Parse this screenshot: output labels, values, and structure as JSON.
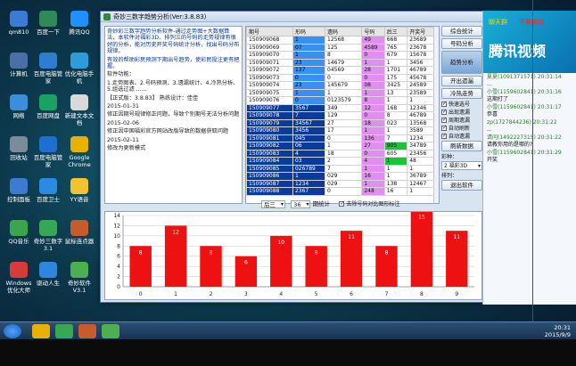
{
  "desktop_icons": [
    {
      "label": "qm810",
      "color": "#3a7bd5"
    },
    {
      "label": "百度一下",
      "color": "#2e8b57"
    },
    {
      "label": "腾讯QQ",
      "color": "#1e90ff"
    },
    {
      "label": "计算机",
      "color": "#4a6fa5"
    },
    {
      "label": "百度电脑管家",
      "color": "#2d7dd2"
    },
    {
      "label": "优化电脑手机",
      "color": "#2d9cdb"
    },
    {
      "label": "网络",
      "color": "#3a8edb"
    },
    {
      "label": "百度网盘",
      "color": "#1aa260"
    },
    {
      "label": "新建文本文档",
      "color": "#d9d9d9"
    },
    {
      "label": "回收站",
      "color": "#7a8b99"
    },
    {
      "label": "百度电脑管家",
      "color": "#1d6fd2"
    },
    {
      "label": "Google Chrome",
      "color": "#e8b100"
    },
    {
      "label": "控制面板",
      "color": "#3b7bd0"
    },
    {
      "label": "百度卫士",
      "color": "#2b8be0"
    },
    {
      "label": "YY语音",
      "color": "#f2c230"
    },
    {
      "label": "QQ音乐",
      "color": "#3aa64b"
    },
    {
      "label": "奇妙三数字3.1",
      "color": "#34a853"
    },
    {
      "label": "鼠标连点器",
      "color": "#c85b2b"
    },
    {
      "label": "Windows优化大师",
      "color": "#d93a3a"
    },
    {
      "label": "驱动人生",
      "color": "#2e86de"
    },
    {
      "label": "奇妙软件V3.1",
      "color": "#4caf50"
    }
  ],
  "window": {
    "title": "奇妙三数字趋势分析(Ver:3.8.83)"
  },
  "intro": [
    "奇妙彩三数字趋势分析软件-通过走势图+大数据算法，本软件对福彩3D、排列三的号码的走势规律有很好的分析，能对历史开奖号码统计分析，找出号码分布规律。",
    "有效的帮助彩民预测下期出号趋势，使彩民投注更有把握。",
    "软件功能：",
    "1.走势图表、2.号码预测、3.遗漏统计、4.冷热分析、5.组选过滤 ......",
    "【正式版：3.8.83】 熟练设计：佳佳",
    "2015-01-31",
    "修正因期号规律修正问题，导致个别期号无法分析问题",
    "2015-02-06",
    "修正因中国福彩官方网站改版导致的数据获取问题",
    "2015-02-11",
    "修改为更新模式"
  ],
  "table": {
    "headers": [
      "期号",
      "形码",
      "遗码",
      "号码",
      "后三",
      "开奖号"
    ],
    "rows": [
      [
        "150909068",
        "1",
        "12568",
        "49",
        "668",
        "23689"
      ],
      [
        "150909069",
        "07",
        "125",
        "4589",
        "765",
        "23678"
      ],
      [
        "150909070",
        "1",
        "8",
        "0",
        "679",
        "15678"
      ],
      [
        "150909071",
        "23",
        "14679",
        "1",
        "1",
        "3456"
      ],
      [
        "150909072",
        "137",
        "04569",
        "28",
        "1701",
        "46789"
      ],
      [
        "150909073",
        "0",
        "0",
        "0",
        "175",
        "45678"
      ],
      [
        "150909074",
        "23",
        "145679",
        "08",
        "3425",
        "24589"
      ],
      [
        "150909075",
        "1",
        "1",
        "1",
        "13",
        "23589"
      ],
      [
        "150909076",
        "0",
        "0123579",
        "8",
        "1",
        "1"
      ],
      [
        "150909077",
        "3567",
        "349",
        "12",
        "168",
        "12346"
      ],
      [
        "150909078",
        "7",
        "129",
        "0",
        "8",
        "46789"
      ],
      [
        "150909079",
        "34567",
        "27",
        "18",
        "023",
        "13568"
      ],
      [
        "150909080",
        "3456",
        "17",
        "1",
        "1",
        "3589"
      ],
      [
        "150909081",
        "045",
        "0",
        "136",
        "7",
        "1234"
      ],
      [
        "150909082",
        "06",
        "1",
        "27",
        "905",
        "34789"
      ],
      [
        "150909083",
        "4",
        "18",
        "0",
        "605",
        "23456"
      ],
      [
        "150909084",
        "03",
        "2",
        "4",
        "1",
        "48"
      ],
      [
        "150909085",
        "026789",
        "7",
        "1",
        "1",
        "1"
      ],
      [
        "150909086",
        "1",
        "029",
        "16",
        "1",
        "36789"
      ],
      [
        "150909087",
        "1234",
        "029",
        "1",
        "138",
        "12467"
      ],
      [
        "150909088",
        "2367",
        "0",
        "248",
        "16",
        "1"
      ]
    ]
  },
  "buttons": {
    "b1": "综合统计",
    "b2": "号码分析",
    "b3": "趋势分析",
    "b4": "开出遗漏",
    "b5": "冷热走势",
    "b6": "刷新数据",
    "b7": "退出软件"
  },
  "checks": [
    "快速选号",
    "出现遗漏",
    "周期遗漏",
    "自动刷新",
    "自动遗漏"
  ],
  "select_label": "彩种：",
  "select_value": "2 福彩3D",
  "select2_label": "排列：",
  "ctrl": {
    "sel_label": "后三",
    "count": "36",
    "count_label": "期统计",
    "checkbox_label": "去除号码对比图形标注"
  },
  "chart_data": {
    "type": "bar",
    "categories": [
      "0",
      "1",
      "2",
      "3",
      "4",
      "5",
      "6",
      "7",
      "8",
      "9"
    ],
    "values": [
      8,
      12,
      8,
      6,
      10,
      8,
      11,
      8,
      15,
      11
    ],
    "ylim": [
      0,
      14
    ],
    "yticks": [
      0,
      2,
      4,
      6,
      8,
      10,
      12,
      14
    ],
    "bar_color": "#ee1111",
    "grid": true
  },
  "side": {
    "banner": "腾讯视频",
    "tip": "不要关闭",
    "tip2": "聊天群",
    "messages": [
      {
        "who": "夏夏(1091371571)",
        "time": "20:31:14",
        "text": "..."
      },
      {
        "who": "小雪(1159602841)",
        "time": "20:31:16",
        "text": "这期打了"
      },
      {
        "who": "小雪(1159602841)",
        "time": "20:31:17",
        "text": "恭喜"
      },
      {
        "who": "zp(1727844236)",
        "time": "20:31:22",
        "text": "..."
      },
      {
        "who": "请问(1492227315)",
        "time": "20:31:22",
        "text": "请教你用的是哪的?"
      },
      {
        "who": "小雪(1159602841)",
        "time": "20:31:29",
        "text": "开奖"
      }
    ]
  },
  "clock": {
    "time": "20:31",
    "date": "2015/9/9"
  }
}
